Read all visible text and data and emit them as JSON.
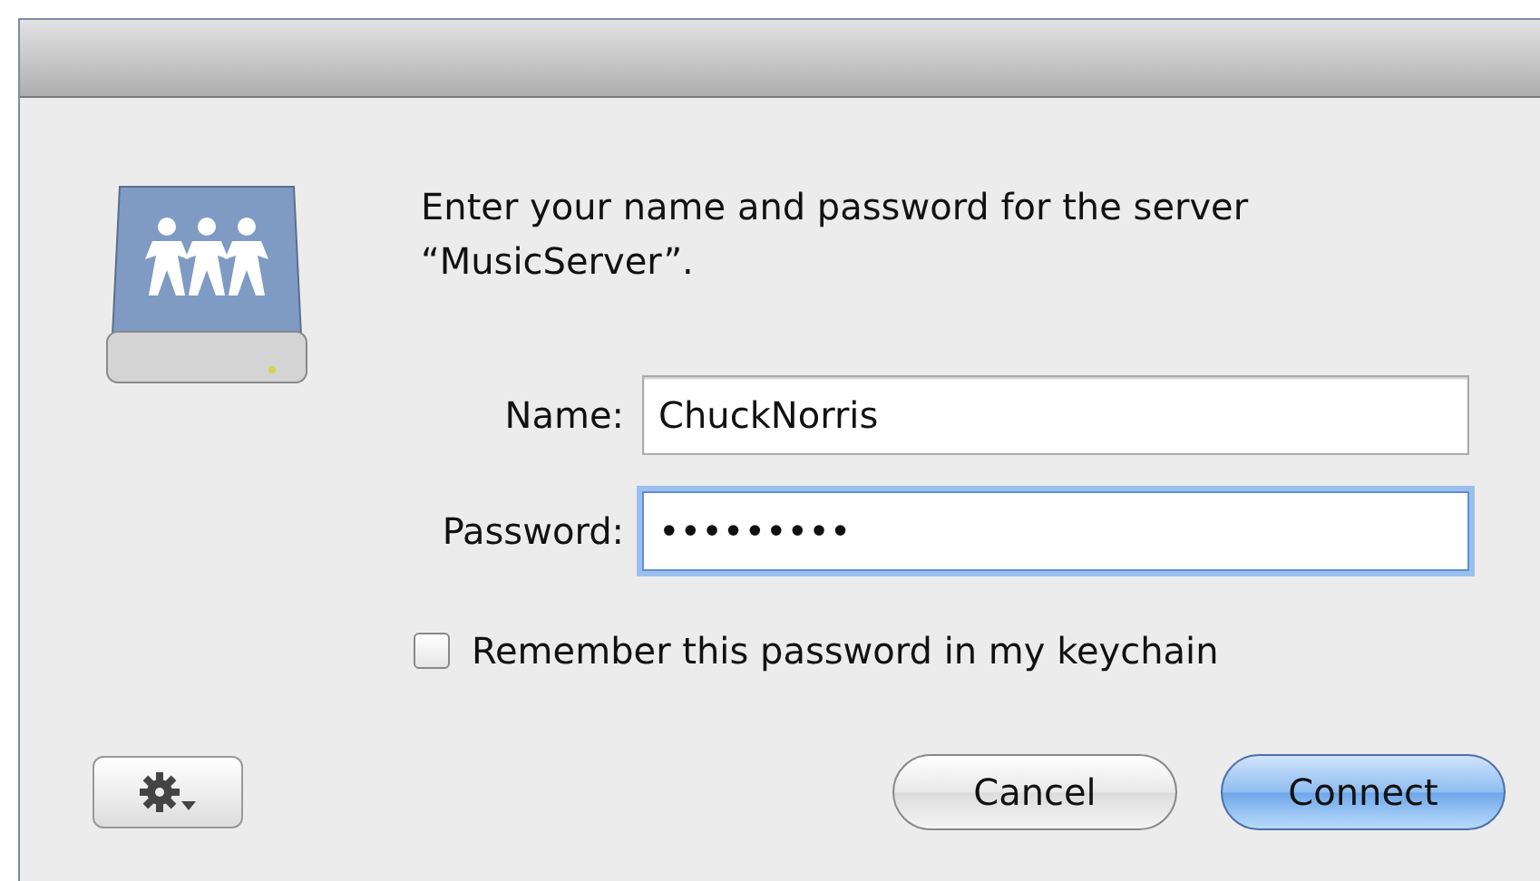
{
  "dialog": {
    "message": "Enter your name and password for the server “MusicServer”.",
    "fields": [
      {
        "label": "Name:",
        "value": "ChuckNorris",
        "focused": false
      },
      {
        "label": "Password:",
        "value": "•••••••••",
        "focused": true
      }
    ],
    "remember": {
      "label": "Remember this password in my keychain",
      "checked": false
    },
    "buttons": [
      {
        "label": "Cancel",
        "default": false
      },
      {
        "label": "Connect",
        "default": true
      }
    ]
  }
}
